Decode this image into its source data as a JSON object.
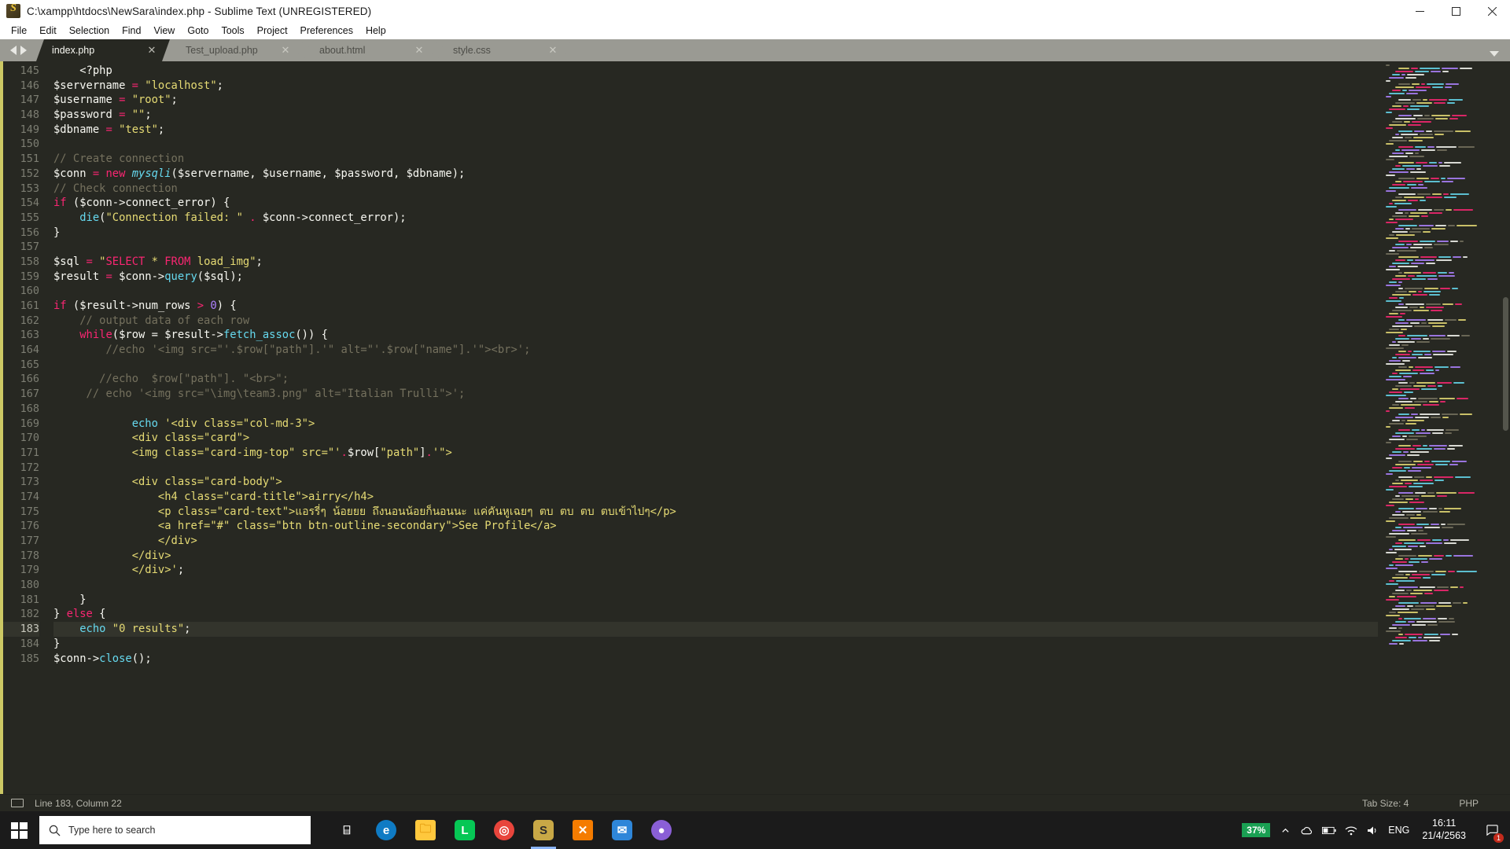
{
  "window": {
    "title": "C:\\xampp\\htdocs\\NewSara\\index.php - Sublime Text (UNREGISTERED)",
    "app_icon": "sublime-text-logo",
    "minimize_label": "–",
    "maximize_label": "□",
    "close_label": "✕"
  },
  "menubar": {
    "items": [
      {
        "label": "File"
      },
      {
        "label": "Edit"
      },
      {
        "label": "Selection"
      },
      {
        "label": "Find"
      },
      {
        "label": "View"
      },
      {
        "label": "Goto"
      },
      {
        "label": "Tools"
      },
      {
        "label": "Project"
      },
      {
        "label": "Preferences"
      },
      {
        "label": "Help"
      }
    ]
  },
  "tabs": {
    "close_glyph": "✕",
    "items": [
      {
        "label": "index.php",
        "active": true
      },
      {
        "label": "Test_upload.php",
        "active": false
      },
      {
        "label": "about.html",
        "active": false
      },
      {
        "label": "style.css",
        "active": false
      }
    ]
  },
  "editor": {
    "first_line": 145,
    "current_line": 183,
    "lines": [
      {
        "n": 145,
        "tokens": [
          {
            "t": "    ",
            "c": "c-pln"
          },
          {
            "t": "<?php",
            "c": "c-pln"
          }
        ]
      },
      {
        "n": 146,
        "tokens": [
          {
            "t": "$servername",
            "c": "c-var"
          },
          {
            "t": " = ",
            "c": "c-op"
          },
          {
            "t": "\"localhost\"",
            "c": "c-str"
          },
          {
            "t": ";",
            "c": "c-pln"
          }
        ]
      },
      {
        "n": 147,
        "tokens": [
          {
            "t": "$username",
            "c": "c-var"
          },
          {
            "t": " = ",
            "c": "c-op"
          },
          {
            "t": "\"root\"",
            "c": "c-str"
          },
          {
            "t": ";",
            "c": "c-pln"
          }
        ]
      },
      {
        "n": 148,
        "tokens": [
          {
            "t": "$password",
            "c": "c-var"
          },
          {
            "t": " = ",
            "c": "c-op"
          },
          {
            "t": "\"\"",
            "c": "c-str"
          },
          {
            "t": ";",
            "c": "c-pln"
          }
        ]
      },
      {
        "n": 149,
        "tokens": [
          {
            "t": "$dbname",
            "c": "c-var"
          },
          {
            "t": " = ",
            "c": "c-op"
          },
          {
            "t": "\"test\"",
            "c": "c-str"
          },
          {
            "t": ";",
            "c": "c-pln"
          }
        ]
      },
      {
        "n": 150,
        "tokens": []
      },
      {
        "n": 151,
        "tokens": [
          {
            "t": "// Create connection",
            "c": "c-cmt"
          }
        ]
      },
      {
        "n": 152,
        "tokens": [
          {
            "t": "$conn",
            "c": "c-var"
          },
          {
            "t": " = ",
            "c": "c-op"
          },
          {
            "t": "new",
            "c": "c-kw"
          },
          {
            "t": " ",
            "c": "c-pln"
          },
          {
            "t": "mysqli",
            "c": "c-cls"
          },
          {
            "t": "($servername, $username, $password, $dbname);",
            "c": "c-pln"
          }
        ]
      },
      {
        "n": 153,
        "tokens": [
          {
            "t": "// Check connection",
            "c": "c-cmt"
          }
        ]
      },
      {
        "n": 154,
        "tokens": [
          {
            "t": "if",
            "c": "c-kw"
          },
          {
            "t": " ($conn->connect_error) {",
            "c": "c-pln"
          }
        ]
      },
      {
        "n": 155,
        "tokens": [
          {
            "t": "    ",
            "c": "c-pln"
          },
          {
            "t": "die",
            "c": "c-fn"
          },
          {
            "t": "(",
            "c": "c-pln"
          },
          {
            "t": "\"Connection failed: \"",
            "c": "c-str"
          },
          {
            "t": " ",
            "c": "c-pln"
          },
          {
            "t": ".",
            "c": "c-op"
          },
          {
            "t": " $conn->connect_error);",
            "c": "c-pln"
          }
        ]
      },
      {
        "n": 156,
        "tokens": [
          {
            "t": "}",
            "c": "c-pln"
          }
        ]
      },
      {
        "n": 157,
        "tokens": []
      },
      {
        "n": 158,
        "tokens": [
          {
            "t": "$sql",
            "c": "c-var"
          },
          {
            "t": " = ",
            "c": "c-op"
          },
          {
            "t": "\"",
            "c": "c-str"
          },
          {
            "t": "SELECT",
            "c": "c-sqlkw"
          },
          {
            "t": " * ",
            "c": "c-str"
          },
          {
            "t": "FROM",
            "c": "c-sqlkw"
          },
          {
            "t": " load_img\"",
            "c": "c-str"
          },
          {
            "t": ";",
            "c": "c-pln"
          }
        ]
      },
      {
        "n": 159,
        "tokens": [
          {
            "t": "$result",
            "c": "c-var"
          },
          {
            "t": " = ",
            "c": "c-op"
          },
          {
            "t": "$conn->",
            "c": "c-pln"
          },
          {
            "t": "query",
            "c": "c-fn"
          },
          {
            "t": "($sql);",
            "c": "c-pln"
          }
        ]
      },
      {
        "n": 160,
        "tokens": []
      },
      {
        "n": 161,
        "tokens": [
          {
            "t": "if",
            "c": "c-kw"
          },
          {
            "t": " ($result->num_rows ",
            "c": "c-pln"
          },
          {
            "t": ">",
            "c": "c-op"
          },
          {
            "t": " ",
            "c": "c-pln"
          },
          {
            "t": "0",
            "c": "c-num"
          },
          {
            "t": ") {",
            "c": "c-pln"
          }
        ]
      },
      {
        "n": 162,
        "tokens": [
          {
            "t": "    ",
            "c": "c-pln"
          },
          {
            "t": "// output data of each row",
            "c": "c-cmt"
          }
        ]
      },
      {
        "n": 163,
        "tokens": [
          {
            "t": "    ",
            "c": "c-pln"
          },
          {
            "t": "while",
            "c": "c-kw"
          },
          {
            "t": "($row = $result->",
            "c": "c-pln"
          },
          {
            "t": "fetch_assoc",
            "c": "c-fn"
          },
          {
            "t": "()) {",
            "c": "c-pln"
          }
        ]
      },
      {
        "n": 164,
        "tokens": [
          {
            "t": "        ",
            "c": "c-pln"
          },
          {
            "t": "//echo '<img src=\"'.$row[\"path\"].'\" alt=\"'.$row[\"name\"].'\"><br>';",
            "c": "c-cmt"
          }
        ]
      },
      {
        "n": 165,
        "tokens": []
      },
      {
        "n": 166,
        "tokens": [
          {
            "t": "       ",
            "c": "c-pln"
          },
          {
            "t": "//echo  $row[\"path\"]. \"<br>\";",
            "c": "c-cmt"
          }
        ]
      },
      {
        "n": 167,
        "tokens": [
          {
            "t": "     ",
            "c": "c-pln"
          },
          {
            "t": "// echo '<img src=\"\\img\\team3.png\" alt=\"Italian Trulli\">';",
            "c": "c-cmt"
          }
        ]
      },
      {
        "n": 168,
        "tokens": []
      },
      {
        "n": 169,
        "tokens": [
          {
            "t": "            ",
            "c": "c-pln"
          },
          {
            "t": "echo",
            "c": "c-fn"
          },
          {
            "t": " ",
            "c": "c-pln"
          },
          {
            "t": "'<div class=\"col-md-3\">",
            "c": "c-str"
          }
        ]
      },
      {
        "n": 170,
        "tokens": [
          {
            "t": "            ",
            "c": "c-pln"
          },
          {
            "t": "<div class=\"card\">",
            "c": "c-str"
          }
        ]
      },
      {
        "n": 171,
        "tokens": [
          {
            "t": "            ",
            "c": "c-pln"
          },
          {
            "t": "<img class=\"card-img-top\" src=\"'",
            "c": "c-str"
          },
          {
            "t": ".",
            "c": "c-op"
          },
          {
            "t": "$row[",
            "c": "c-pln"
          },
          {
            "t": "\"path\"",
            "c": "c-str"
          },
          {
            "t": "]",
            "c": "c-pln"
          },
          {
            "t": ".",
            "c": "c-op"
          },
          {
            "t": "'\">",
            "c": "c-str"
          }
        ]
      },
      {
        "n": 172,
        "tokens": []
      },
      {
        "n": 173,
        "tokens": [
          {
            "t": "            ",
            "c": "c-pln"
          },
          {
            "t": "<div class=\"card-body\">",
            "c": "c-str"
          }
        ]
      },
      {
        "n": 174,
        "tokens": [
          {
            "t": "                ",
            "c": "c-pln"
          },
          {
            "t": "<h4 class=\"card-title\">airry</h4>",
            "c": "c-str"
          }
        ]
      },
      {
        "n": 175,
        "tokens": [
          {
            "t": "                ",
            "c": "c-pln"
          },
          {
            "t": "<p class=\"card-text\">แอรรี่ๆ น้อยยย ถึงนอนน้อยก็นอนนะ แค่คันหูเฉยๆ ตบ ตบ ตบ ตบเข้าไปๆ</p>",
            "c": "c-str"
          }
        ]
      },
      {
        "n": 176,
        "tokens": [
          {
            "t": "                ",
            "c": "c-pln"
          },
          {
            "t": "<a href=\"#\" class=\"btn btn-outline-secondary\">See Profile</a>",
            "c": "c-str"
          }
        ]
      },
      {
        "n": 177,
        "tokens": [
          {
            "t": "                ",
            "c": "c-pln"
          },
          {
            "t": "</div>",
            "c": "c-str"
          }
        ]
      },
      {
        "n": 178,
        "tokens": [
          {
            "t": "            ",
            "c": "c-pln"
          },
          {
            "t": "</div>",
            "c": "c-str"
          }
        ]
      },
      {
        "n": 179,
        "tokens": [
          {
            "t": "            ",
            "c": "c-pln"
          },
          {
            "t": "</div>'",
            "c": "c-str"
          },
          {
            "t": ";",
            "c": "c-pln"
          }
        ]
      },
      {
        "n": 180,
        "tokens": []
      },
      {
        "n": 181,
        "tokens": [
          {
            "t": "    }",
            "c": "c-pln"
          }
        ]
      },
      {
        "n": 182,
        "tokens": [
          {
            "t": "} ",
            "c": "c-pln"
          },
          {
            "t": "else",
            "c": "c-kw"
          },
          {
            "t": " {",
            "c": "c-pln"
          }
        ]
      },
      {
        "n": 183,
        "tokens": [
          {
            "t": "    ",
            "c": "c-pln"
          },
          {
            "t": "echo",
            "c": "c-fn"
          },
          {
            "t": " ",
            "c": "c-pln"
          },
          {
            "t": "\"0 results\"",
            "c": "c-str"
          },
          {
            "t": ";",
            "c": "c-pln"
          }
        ]
      },
      {
        "n": 184,
        "tokens": [
          {
            "t": "}",
            "c": "c-pln"
          }
        ]
      },
      {
        "n": 185,
        "tokens": [
          {
            "t": "$conn->",
            "c": "c-pln"
          },
          {
            "t": "close",
            "c": "c-fn"
          },
          {
            "t": "();",
            "c": "c-pln"
          }
        ]
      }
    ]
  },
  "statusbar": {
    "cursor": "Line 183, Column 22",
    "tab_size": "Tab Size: 4",
    "syntax": "PHP"
  },
  "taskbar": {
    "start_icon": "windows-logo-icon",
    "search_placeholder": "Type here to search",
    "search_icon": "search-icon",
    "apps": [
      {
        "name": "task-view-icon",
        "glyph": "⌸"
      },
      {
        "name": "microsoft-edge-icon",
        "glyph": "e"
      },
      {
        "name": "file-explorer-icon",
        "glyph": "🗀"
      },
      {
        "name": "line-app-icon",
        "glyph": "L"
      },
      {
        "name": "chrome-icon",
        "glyph": "◎"
      },
      {
        "name": "sublime-text-icon",
        "glyph": "S"
      },
      {
        "name": "xampp-control-panel-icon",
        "glyph": "✕"
      },
      {
        "name": "mail-app-icon",
        "glyph": "✉"
      },
      {
        "name": "chrome-canary-icon",
        "glyph": "●"
      }
    ],
    "tray": {
      "battery_percent": "37%",
      "chevron_icon": "chevron-up-icon",
      "cloud_icon": "onedrive-icon",
      "battery_icon": "battery-icon",
      "network_icon": "network-icon",
      "volume_icon": "volume-icon",
      "language": "ENG",
      "time": "16:11",
      "date": "21/4/2563",
      "notification_icon": "notification-icon",
      "notification_count": "1"
    }
  },
  "minimap": {
    "colors": [
      "#75715e",
      "#e6db74",
      "#f92672",
      "#66d9ef",
      "#ae81ff",
      "#f8f8f2"
    ]
  }
}
